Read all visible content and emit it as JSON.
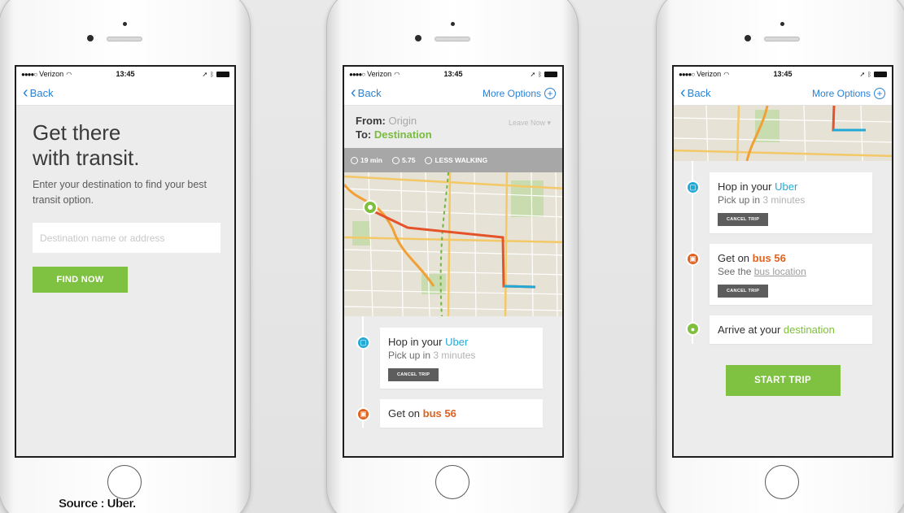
{
  "status_bar": {
    "carrier": "Verizon",
    "time": "13:45"
  },
  "nav": {
    "back_label": "Back",
    "more_options_label": "More Options"
  },
  "screen1": {
    "title_line1": "Get there",
    "title_line2": "with transit.",
    "subtitle": "Enter your destination to find your best transit option.",
    "destination_placeholder": "Destination name or address",
    "find_button": "FIND NOW"
  },
  "screen2": {
    "from_label": "From:",
    "from_value": "Origin",
    "to_label": "To:",
    "to_value": "Destination",
    "leave_label": "Leave Now ▾",
    "info": {
      "duration": "19 min",
      "price": "5.75",
      "walking": "LESS WALKING"
    }
  },
  "steps": {
    "uber": {
      "prefix": "Hop in your ",
      "highlight": "Uber",
      "pickup_prefix": "Pick up in ",
      "pickup_value": "3 minutes"
    },
    "bus": {
      "prefix": "Get on ",
      "highlight": "bus 56",
      "see_prefix": "See the ",
      "see_link": "bus location"
    },
    "arrive": {
      "prefix": "Arrive at your ",
      "highlight": "destination"
    },
    "cancel_label": "CANCEL TRIP"
  },
  "screen3": {
    "start_button": "START TRIP"
  },
  "colors": {
    "green": "#7fc241",
    "uber_blue": "#23a9d6",
    "bus_orange": "#e0621f",
    "link_blue": "#2a82d6"
  },
  "caption": "Source : Uber."
}
